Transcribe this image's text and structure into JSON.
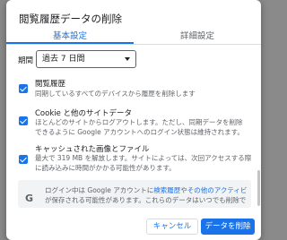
{
  "dialog": {
    "title": "閲覧履歴データの削除",
    "tabs": [
      {
        "label": "基本設定",
        "active": true
      },
      {
        "label": "詳細設定",
        "active": false
      }
    ],
    "period": {
      "label": "期間",
      "selected": "過去 7 日間"
    },
    "items": [
      {
        "title": "閲覧履歴",
        "desc": [
          "同期しているすべてのデバイスから履歴を削除します"
        ],
        "checked": true
      },
      {
        "title": "Cookie と他のサイトデータ",
        "desc": [
          "ほとんどのサイトからログアウトします。ただし、同期データを削除",
          "できるように Google アカウントへのログイン状態は維持されます。"
        ],
        "checked": true
      },
      {
        "title": "キャッシュされた画像とファイル",
        "desc": [
          "最大で 319 MB を解放します。サイトによっては、次回アクセスする際",
          "に読み込みに時間がかかる可能性があります。"
        ],
        "checked": true
      }
    ],
    "info": {
      "line1_prefix": "ログイン中は Google アカウントに",
      "link1": "検索履歴",
      "line1_mid": "や",
      "link2": "その他のアクティビティ",
      "line2": "が保存される可能性があります。これらのデータはいつでも削除で"
    },
    "buttons": {
      "cancel": "キャンセル",
      "delete": "データを削除"
    },
    "accent_color": "#1a73e8"
  }
}
